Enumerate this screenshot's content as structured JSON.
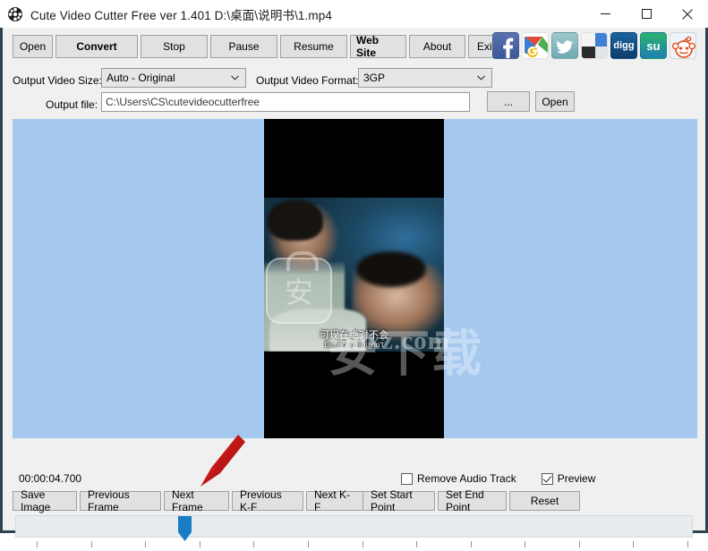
{
  "window": {
    "title": "Cute Video Cutter Free ver 1.401  D:\\桌面\\说明书\\1.mp4",
    "icon": "film-reel-icon",
    "controls": {
      "minimize": "minimize-icon",
      "maximize": "maximize-icon",
      "close": "close-icon"
    }
  },
  "toolbar": {
    "buttons": [
      {
        "label": "Open",
        "bold": false
      },
      {
        "label": "Convert",
        "bold": true
      },
      {
        "label": "Stop",
        "bold": false
      },
      {
        "label": "Pause",
        "bold": false
      },
      {
        "label": "Resume",
        "bold": false
      },
      {
        "label": "Web Site",
        "bold": true
      },
      {
        "label": "About",
        "bold": false
      },
      {
        "label": "Exit",
        "bold": false
      }
    ]
  },
  "social": [
    {
      "name": "facebook-icon",
      "color": "#3b5998"
    },
    {
      "name": "google-icon",
      "color": "#dd4b39"
    },
    {
      "name": "twitter-icon",
      "color": "#55acee"
    },
    {
      "name": "windows-tile-icon",
      "color": "#2f78d2"
    },
    {
      "name": "digg-icon",
      "color": "#14589e",
      "label": "digg"
    },
    {
      "name": "stumbleupon-icon",
      "color": "#1f9c61",
      "label": "su"
    },
    {
      "name": "reddit-icon",
      "color": "#ff4500"
    }
  ],
  "settings": {
    "video_size_label": "Output Video Size:",
    "video_size_value": "Auto - Original",
    "video_format_label": "Output Video Format:",
    "video_format_value": "3GP",
    "output_file_label": "Output file:",
    "output_file_value": "C:\\Users\\CS\\cutevideocutterfree",
    "browse_label": "...",
    "open_label": "Open"
  },
  "preview": {
    "panel_color": "#a5c8ee",
    "subtitle_cn": "可现在绝对不会",
    "subtitle_en": "But now, wouldn't",
    "watermark_badge_char": "安",
    "watermark_cn": "安下载",
    "watermark_url": "anxz.com"
  },
  "annotation": {
    "arrow_name": "red-arrow-pointing-to-next-frame",
    "arrow_color": "#d31616"
  },
  "playback": {
    "timecode": "00:00:04.700",
    "frame_buttons": [
      "Save Image",
      "Previous Frame",
      "Next Frame",
      "Previous K-F",
      "Next K-F"
    ],
    "point_buttons": [
      "Set  Start Point",
      "Set  End Point",
      "Reset"
    ],
    "checkboxes": [
      {
        "label": "Remove Audio Track",
        "checked": false
      },
      {
        "label": "Preview",
        "checked": true
      }
    ],
    "slider": {
      "position_percent": 25,
      "thumb_color": "#1a7dc4",
      "tick_count": 13
    }
  }
}
